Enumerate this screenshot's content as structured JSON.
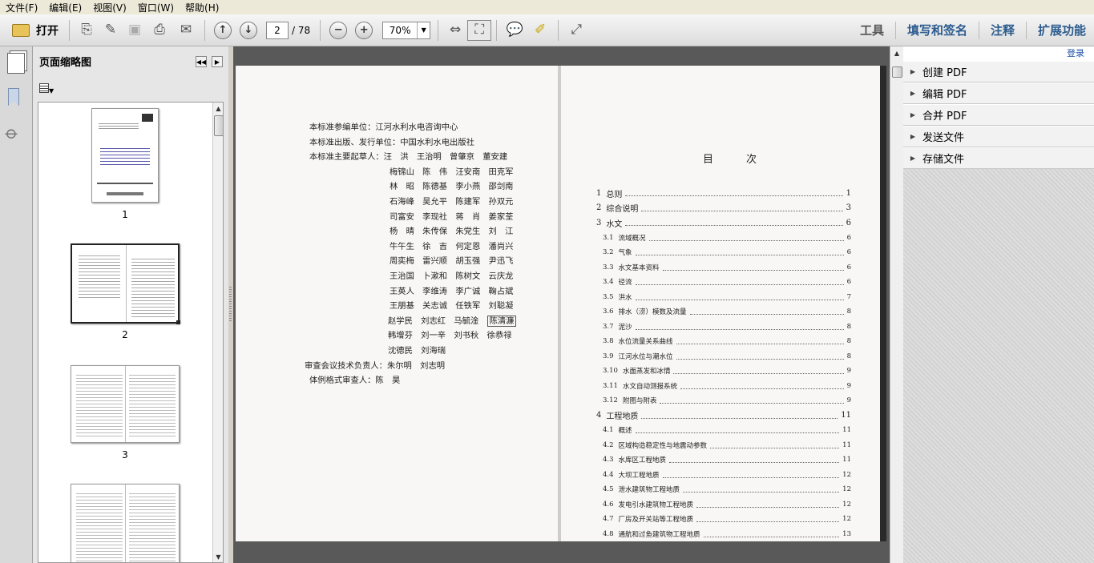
{
  "menubar": {
    "items": [
      "文件(F)",
      "编辑(E)",
      "视图(V)",
      "窗口(W)",
      "帮助(H)"
    ]
  },
  "toolbar": {
    "open_label": "打开",
    "current_page": "2",
    "page_total": "/ 78",
    "zoom": "70%",
    "links": [
      "工具",
      "填写和签名",
      "注释",
      "扩展功能"
    ]
  },
  "thumbnails": {
    "title": "页面缩略图",
    "pages": [
      "1",
      "2",
      "3"
    ]
  },
  "right_panel": {
    "login": "登录",
    "items": [
      "创建 PDF",
      "编辑 PDF",
      "合并 PDF",
      "发送文件",
      "存储文件"
    ]
  },
  "document": {
    "credits": [
      "本标准参编单位：江河水利水电咨询中心",
      "本标准出版、发行单位：中国水利水电出版社",
      "本标准主要起草人：汪　洪　王治明　曾肇京　董安建",
      "梅锦山　陈　伟　汪安南　田克军",
      "林　昭　陈德基　李小燕　邵剑南",
      "石海峰　吴允平　陈建军　孙双元",
      "司富安　李现社　蒋　肖　姜家荃",
      "杨　晴　朱传保　朱党生　刘　江",
      "牛午生　徐　吉　何定恩　潘尚兴",
      "周奕梅　雷兴顺　胡玉强　尹迅飞",
      "王治国　卜漱和　陈树文　云庆龙",
      "王英人　李维涛　李广诚　鞠占斌",
      "王朋基　关志诚　任铁军　刘聪凝",
      "赵学民　刘志红　马毓淦",
      "韩增芬　刘一辛　刘书秋　徐恭禄",
      "沈德民　刘海瑞",
      "审查会议技术负责人：朱尔明　刘志明",
      "体例格式审查人：陈　昊"
    ],
    "credits_boxed": "陈清濂",
    "toc_title": "目　次",
    "toc": [
      {
        "num": "1",
        "text": "总则",
        "page": "1",
        "level": 1
      },
      {
        "num": "2",
        "text": "综合说明",
        "page": "3",
        "level": 1
      },
      {
        "num": "3",
        "text": "水文",
        "page": "6",
        "level": 1
      },
      {
        "num": "3.1",
        "text": "流域概况",
        "page": "6",
        "level": 2
      },
      {
        "num": "3.2",
        "text": "气象",
        "page": "6",
        "level": 2
      },
      {
        "num": "3.3",
        "text": "水文基本资料",
        "page": "6",
        "level": 2
      },
      {
        "num": "3.4",
        "text": "径流",
        "page": "6",
        "level": 2
      },
      {
        "num": "3.5",
        "text": "洪水",
        "page": "7",
        "level": 2
      },
      {
        "num": "3.6",
        "text": "排水（涝）模数及流量",
        "page": "8",
        "level": 2
      },
      {
        "num": "3.7",
        "text": "泥沙",
        "page": "8",
        "level": 2
      },
      {
        "num": "3.8",
        "text": "水位流量关系曲线",
        "page": "8",
        "level": 2
      },
      {
        "num": "3.9",
        "text": "江河水位与潮水位",
        "page": "8",
        "level": 2
      },
      {
        "num": "3.10",
        "text": "水面蒸发和冰情",
        "page": "9",
        "level": 2
      },
      {
        "num": "3.11",
        "text": "水文自动测报系统",
        "page": "9",
        "level": 2
      },
      {
        "num": "3.12",
        "text": "附图与附表",
        "page": "9",
        "level": 2
      },
      {
        "num": "4",
        "text": "工程地质",
        "page": "11",
        "level": 1
      },
      {
        "num": "4.1",
        "text": "概述",
        "page": "11",
        "level": 2
      },
      {
        "num": "4.2",
        "text": "区域构造稳定性与地震动参数",
        "page": "11",
        "level": 2
      },
      {
        "num": "4.3",
        "text": "水库区工程地质",
        "page": "11",
        "level": 2
      },
      {
        "num": "4.4",
        "text": "大坝工程地质",
        "page": "12",
        "level": 2
      },
      {
        "num": "4.5",
        "text": "泄水建筑物工程地质",
        "page": "12",
        "level": 2
      },
      {
        "num": "4.6",
        "text": "发电引水建筑物工程地质",
        "page": "12",
        "level": 2
      },
      {
        "num": "4.7",
        "text": "厂房及开关站等工程地质",
        "page": "12",
        "level": 2
      },
      {
        "num": "4.8",
        "text": "通航和过鱼建筑物工程地质",
        "page": "13",
        "level": 2
      }
    ]
  }
}
